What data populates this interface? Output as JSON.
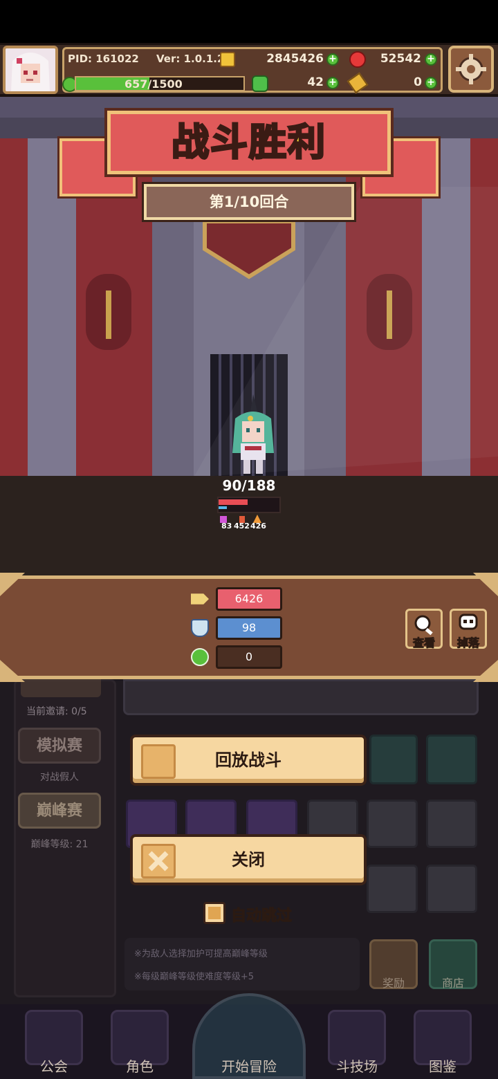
{
  "header": {
    "pid": "PID: 161022",
    "version": "Ver: 1.0.1.2",
    "gold": "2845426",
    "gems": "52542",
    "clover": "42",
    "keys": "0",
    "hp_text": "657/1500",
    "hp_progress": 0.438
  },
  "battle": {
    "title": "战斗胜利",
    "round": "第1/10回合",
    "hero_hp": "90/188",
    "hero_stats": [
      "83",
      "452",
      "426"
    ]
  },
  "stats": {
    "attack": "6426",
    "defense": "98",
    "heal": "0",
    "view_label": "查看",
    "drop_label": "掉落"
  },
  "lower": {
    "invite_status": "当前邀请: 0/5",
    "sim_match": "模拟赛",
    "sim_sub": "对战假人",
    "peak_match": "巅峰赛",
    "peak_level": "巅峰等级: 21",
    "replay_label": "回放战斗",
    "close_label": "关闭",
    "auto_skip_label": "自动跳过",
    "tip1": "※为敌人选择加护可提高巅峰等级",
    "tip2": "※每级巅峰等级使难度等级+5",
    "reward_label": "奖励",
    "shop_label": "商店"
  },
  "nav": {
    "guild": "公会",
    "character": "角色",
    "adventure": "开始冒险",
    "arena": "斗技场",
    "codex": "图鉴"
  },
  "colors": {
    "title_yellow": "#ffe23b",
    "banner_red": "#e05a5a",
    "attack_box": "#e8606e",
    "defense_box": "#5c8fd0",
    "heal_box": "#4a2e22",
    "hp_green": "#59c03b"
  }
}
